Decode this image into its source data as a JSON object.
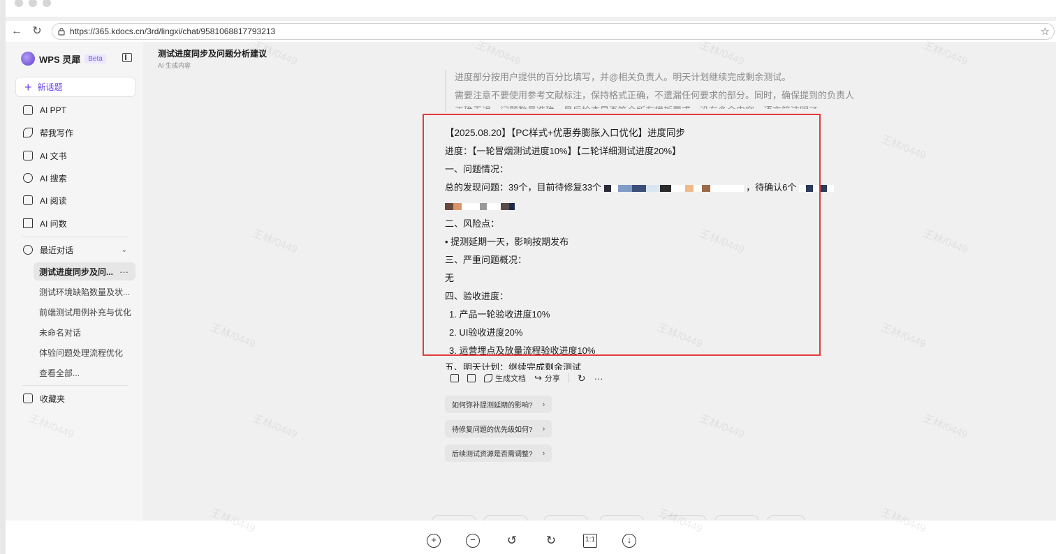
{
  "browser": {
    "url": "https://365.kdocs.cn/3rd/lingxi/chat/9581068817793213"
  },
  "sidebar": {
    "brand": "WPS 灵犀",
    "beta": "Beta",
    "new_topic": "新话题",
    "tools": [
      {
        "label": "AI PPT",
        "icon": "ppt-icon"
      },
      {
        "label": "帮我写作",
        "icon": "pen-icon"
      },
      {
        "label": "AI 文书",
        "icon": "document-icon"
      },
      {
        "label": "AI 搜索",
        "icon": "search-icon"
      },
      {
        "label": "AI 阅读",
        "icon": "book-icon"
      },
      {
        "label": "AI 问数",
        "icon": "data-icon"
      }
    ],
    "recent_label": "最近对话",
    "history": [
      "测试进度同步及问...",
      "测试环境缺陷数量及状...",
      "前端测试用例补充与优化",
      "未命名对话",
      "体验问题处理流程优化",
      "查看全部..."
    ],
    "favorites": "收藏夹"
  },
  "chat": {
    "title": "测试进度同步及问题分析建议",
    "subtitle": "AI 生成内容",
    "reasoning": [
      "进度部分按用户提供的百分比填写，并@相关负责人。明天计划继续完成剩余测试。",
      "需要注意不要使用参考文献标注，保持格式正确，不遗漏任何要求的部分。同时，确保提到的负责人正确无误，问题数量准确。最后检查是否符合所有模板要求，没有多余内容，语言简洁明了。"
    ],
    "answer": {
      "heading": "【2025.08.20】【PC样式+优惠券膨胀入口优化】进度同步",
      "progress": "进度：【一轮冒烟测试进度10%】【二轮详细测试进度20%】",
      "s1_title": "一、问题情况：",
      "s1_text_a": "总的发现问题：39个，目前待修复33个",
      "s1_text_b": "，待确认6个",
      "s2_title": "二、风险点：",
      "s2_item": "• 提测延期一天，影响按期发布",
      "s3_title": "三、严重问题概况：",
      "s3_text": "无",
      "s4_title": "四、验收进度：",
      "s4_items": [
        "1.  产品一轮验收进度10%",
        "2.  UI验收进度20%",
        "3.  运营埋点及放量流程验收进度10%"
      ],
      "s5": "五、明天计划：继续完成剩余测试"
    },
    "actions": {
      "generate_doc": "生成文档",
      "share": "分享"
    },
    "suggestions": [
      "如何弥补提测延期的影响?",
      "待修复问题的优先级如何?",
      "后续测试资源是否需调整?"
    ]
  },
  "watermark": "王林/0449",
  "colors": {
    "accent": "#6b45e8",
    "highlight": "#e33b3b"
  }
}
